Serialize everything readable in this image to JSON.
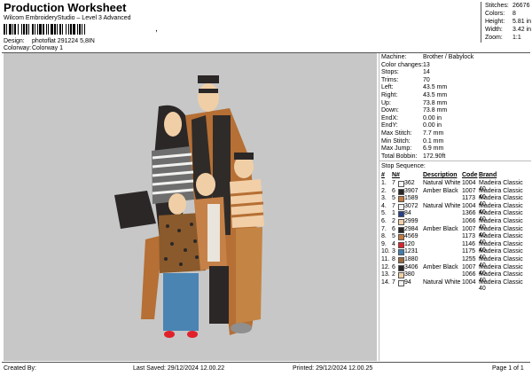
{
  "header": {
    "title": "Production Worksheet",
    "software": "Wilcom EmbroideryStudio – Level 3 Advanced",
    "design_label": "Design:",
    "design_value": "photoflat 291224 5,8IN",
    "colorway_label": "Colorway:",
    "colorway_value": "Colorway 1",
    "barcode_sep": ","
  },
  "stats": {
    "stitches_label": "Stitches:",
    "stitches": "26676",
    "colors_label": "Colors:",
    "colors": "8",
    "height_label": "Height:",
    "height": "5.81 in",
    "width_label": "Width:",
    "width": "3.42 in",
    "zoom_label": "Zoom:",
    "zoom": "1:1"
  },
  "machine": [
    {
      "label": "Machine:",
      "value": "Brother / Babylock"
    },
    {
      "label": "Color changes:",
      "value": "13"
    },
    {
      "label": "Stops:",
      "value": "14"
    },
    {
      "label": "Trims:",
      "value": "70"
    },
    {
      "label": "Left:",
      "value": "43.5 mm"
    },
    {
      "label": "Right:",
      "value": "43.5 mm"
    },
    {
      "label": "Up:",
      "value": "73.8 mm"
    },
    {
      "label": "Down:",
      "value": "73.8 mm"
    },
    {
      "label": "EndX:",
      "value": "0.00 in"
    },
    {
      "label": "EndY:",
      "value": "0.00 in"
    },
    {
      "label": "Max Stitch:",
      "value": "7.7 mm"
    },
    {
      "label": "Min Stitch:",
      "value": "0.1 mm"
    },
    {
      "label": "Max Jump:",
      "value": "6.9 mm"
    },
    {
      "label": "Total Bobbin:",
      "value": "172.90ft"
    }
  ],
  "stop_sequence": {
    "title": "Stop Sequence:",
    "columns": [
      "#",
      "N#",
      "Description",
      "Code",
      "Brand"
    ],
    "rows": [
      {
        "n": "1.",
        "col": "7",
        "color": "#f2f2f0",
        "st": "362",
        "desc": "Natural White",
        "code": "1004",
        "brand": "Madeira Classic 40"
      },
      {
        "n": "2.",
        "col": "6",
        "color": "#2b2726",
        "st": "3907",
        "desc": "Amber Black",
        "code": "1007",
        "brand": "Madeira Classic 40"
      },
      {
        "n": "3.",
        "col": "5",
        "color": "#c47a3d",
        "st": "1589",
        "desc": "",
        "code": "1173",
        "brand": "Madeira Classic 40"
      },
      {
        "n": "4.",
        "col": "7",
        "color": "#f2f2f0",
        "st": "3072",
        "desc": "Natural White",
        "code": "1004",
        "brand": "Madeira Classic 40"
      },
      {
        "n": "5.",
        "col": "1",
        "color": "#27408b",
        "st": "84",
        "desc": "",
        "code": "1366",
        "brand": "Madeira Classic 40"
      },
      {
        "n": "6.",
        "col": "2",
        "color": "#f2cfa7",
        "st": "2999",
        "desc": "",
        "code": "1066",
        "brand": "Madeira Classic 40"
      },
      {
        "n": "7.",
        "col": "6",
        "color": "#2b2726",
        "st": "2984",
        "desc": "Amber Black",
        "code": "1007",
        "brand": "Madeira Classic 40"
      },
      {
        "n": "8.",
        "col": "5",
        "color": "#c47a3d",
        "st": "4569",
        "desc": "",
        "code": "1173",
        "brand": "Madeira Classic 40"
      },
      {
        "n": "9.",
        "col": "4",
        "color": "#e0212b",
        "st": "120",
        "desc": "",
        "code": "1146",
        "brand": "Madeira Classic 40"
      },
      {
        "n": "10.",
        "col": "3",
        "color": "#3f7fb0",
        "st": "1231",
        "desc": "",
        "code": "1175",
        "brand": "Madeira Classic 40"
      },
      {
        "n": "11.",
        "col": "8",
        "color": "#9a6a3b",
        "st": "1880",
        "desc": "",
        "code": "1255",
        "brand": "Madeira Classic 40"
      },
      {
        "n": "12.",
        "col": "6",
        "color": "#2b2726",
        "st": "3406",
        "desc": "Amber Black",
        "code": "1007",
        "brand": "Madeira Classic 40"
      },
      {
        "n": "13.",
        "col": "2",
        "color": "#f2cfa7",
        "st": "380",
        "desc": "",
        "code": "1066",
        "brand": "Madeira Classic 40"
      },
      {
        "n": "14.",
        "col": "7",
        "color": "#f2f2f0",
        "st": "94",
        "desc": "Natural White",
        "code": "1004",
        "brand": "Madeira Classic 40"
      }
    ]
  },
  "footer": {
    "created_by": "Created By:",
    "last_saved": "Last Saved: 29/12/2024 12.00.22",
    "printed": "Printed: 29/12/2024 12.00.25",
    "page": "Page 1 of 1"
  }
}
